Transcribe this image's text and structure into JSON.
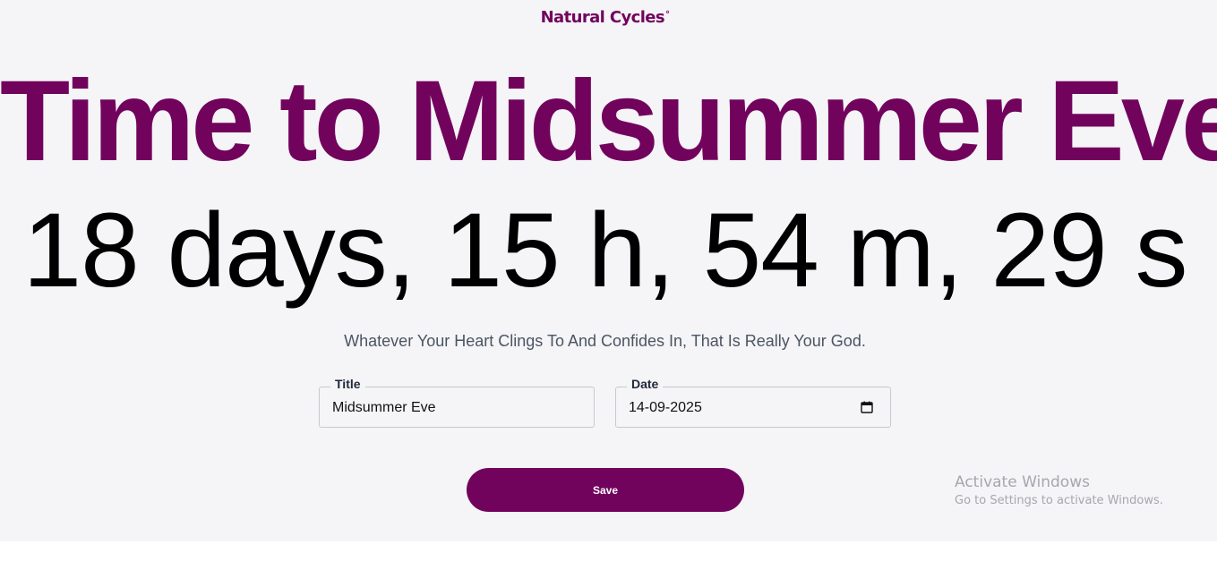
{
  "brand": {
    "name": "Natural Cycles",
    "mark": "°"
  },
  "headline": "Time to Midsummer Eve",
  "countdown": "18 days, 15 h, 54 m, 29 s",
  "quote": "Whatever Your Heart Clings To And Confides In, That Is Really Your God.",
  "form": {
    "title_label": "Title",
    "title_value": "Midsummer Eve",
    "date_label": "Date",
    "date_value": "14-09-2025",
    "save_label": "Save"
  },
  "watermark": {
    "title": "Activate Windows",
    "subtitle": "Go to Settings to activate Windows."
  },
  "colors": {
    "brand": "#72035d",
    "background": "#f5f4f7",
    "text": "#000000"
  },
  "icons": {
    "date": "calendar-icon"
  }
}
